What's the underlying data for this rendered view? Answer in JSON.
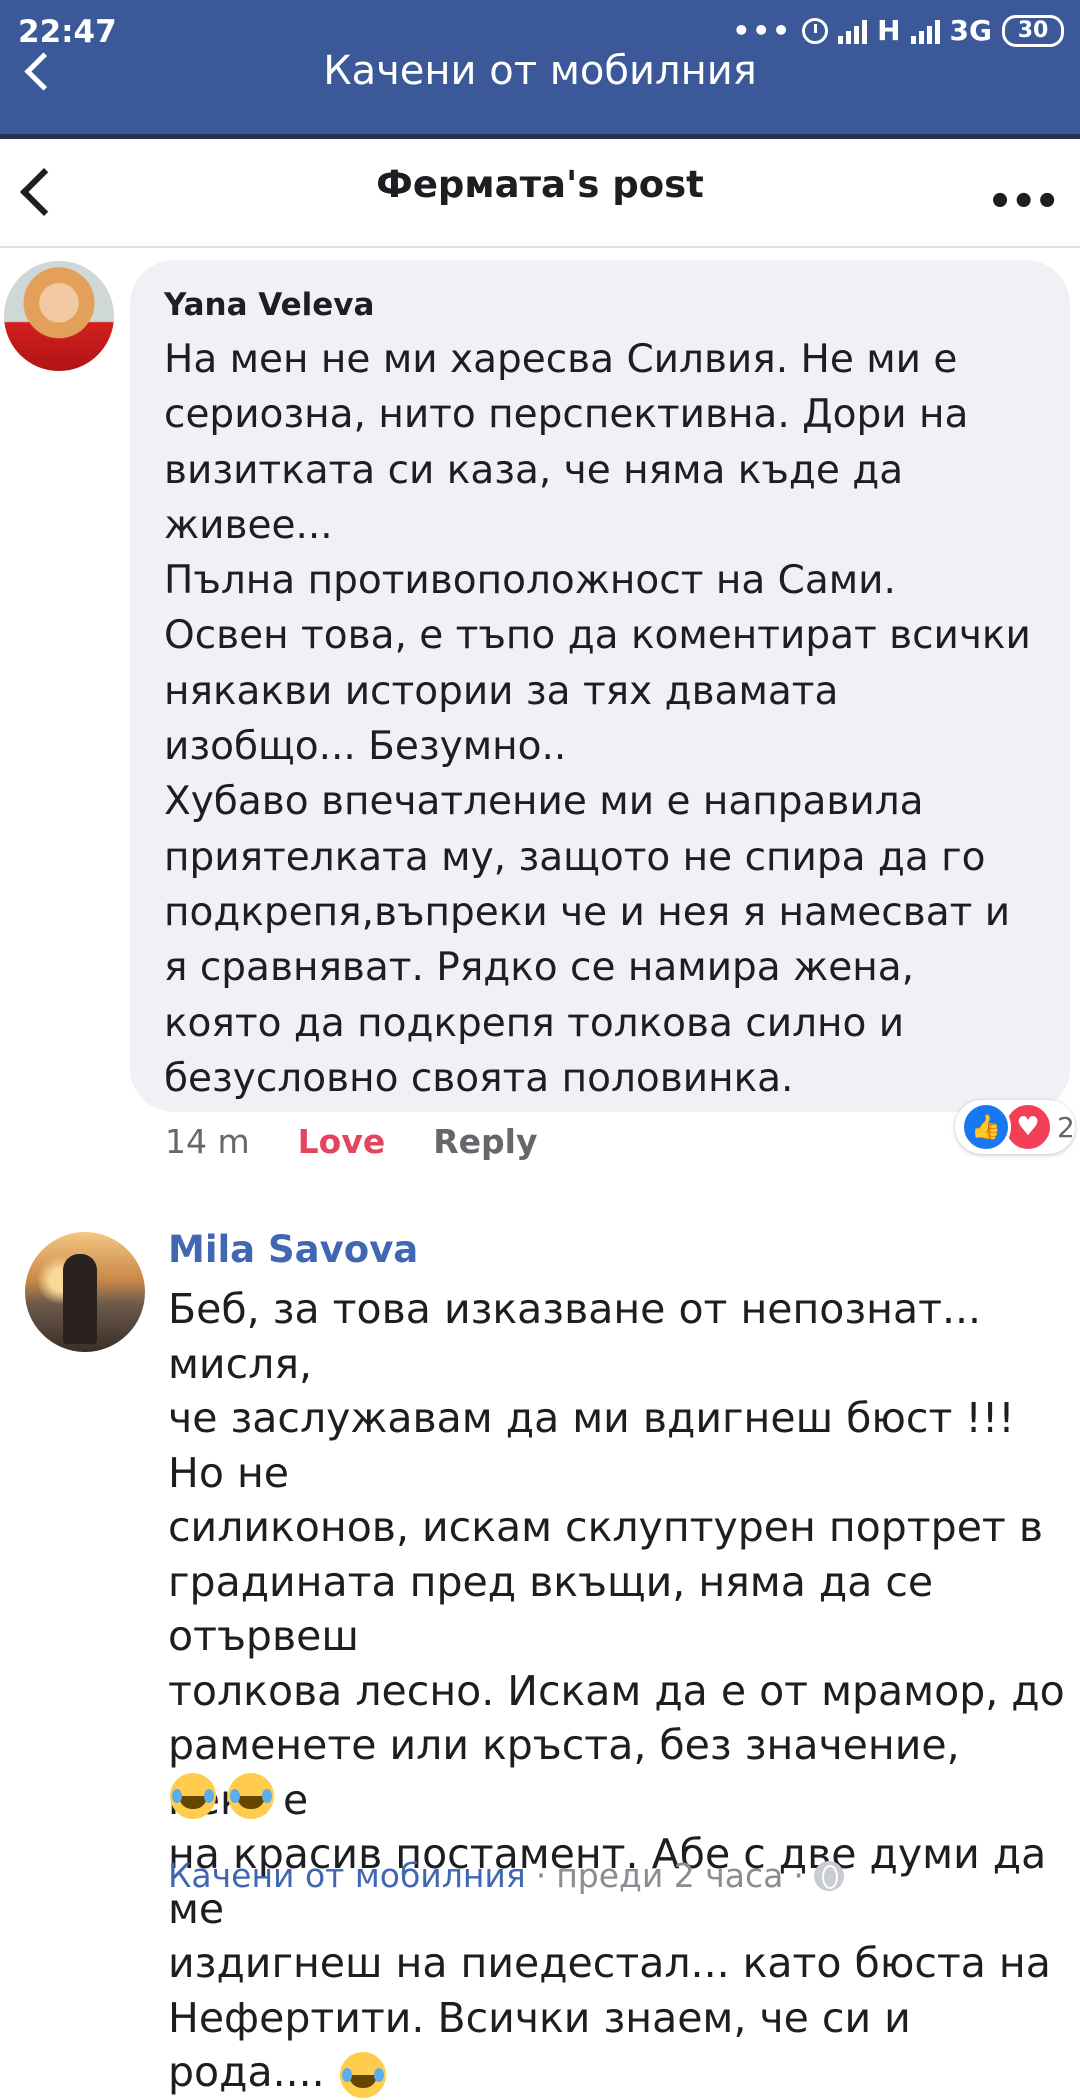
{
  "status_bar": {
    "time": "22:47",
    "network_h": "H",
    "network_3g": "3G",
    "battery": "30"
  },
  "top_header": {
    "title": "Качени от мобилния"
  },
  "post_nav": {
    "title": "Фермата's post"
  },
  "comments": [
    {
      "author": "Yana Veleva",
      "text": "На мен не ми харесва Силвия. Не ми е\nсериозна, нито перспективна. Дори на\nвизитката си каза, че няма къде да\nживее...\nПълна противоположност на Сами.\nОсвен това, е тъпо да коментират всички\nнякакви истории за тях двамата\nизобщо... Безумно..\nХубаво впечатление ми е направила\nприятелката му, защото не спира да го\nподкрепя,въпреки че и нея я намесват и\nя сравняват. Рядко се намира жена,\nкоято да подкрепя толкова силно и\nбезусловно своята половинка.",
      "time": "14 m",
      "love_label": "Love",
      "reply_label": "Reply",
      "reaction_count": "2",
      "reactions": [
        "like-icon",
        "love-icon"
      ]
    },
    {
      "author": "Mila Savova",
      "text": "Беб, за това изказване от непознат... мисля,\nче заслужавам да ми вдигнеш бюст !!! Но не\nсиликонов, искам склуптурен портрет в\nградината пред вкъщи, няма да се отървеш\nтолкова лесно. Искам да е от мрамор, до\nраменете или кръста, без значение, нека е\nна красив постамент. Абе с две думи да ме\nиздигнеш на пиедестал... като бюста на\nНефертити. Всички знаем, че си и рода....",
      "footer_source": "Качени от мобилния",
      "footer_sep": "·",
      "footer_time": "преди 2 часа",
      "footer_sep2": "·",
      "emojis": [
        "laughing-tears-emoji",
        "laughing-tears-emoji",
        "laughing-tears-emoji"
      ]
    }
  ],
  "colors": {
    "header": "#3b5998",
    "bubble": "#f0f1f4",
    "love": "#e4455e",
    "name_link": "#4267b2",
    "like": "#1877f2"
  }
}
